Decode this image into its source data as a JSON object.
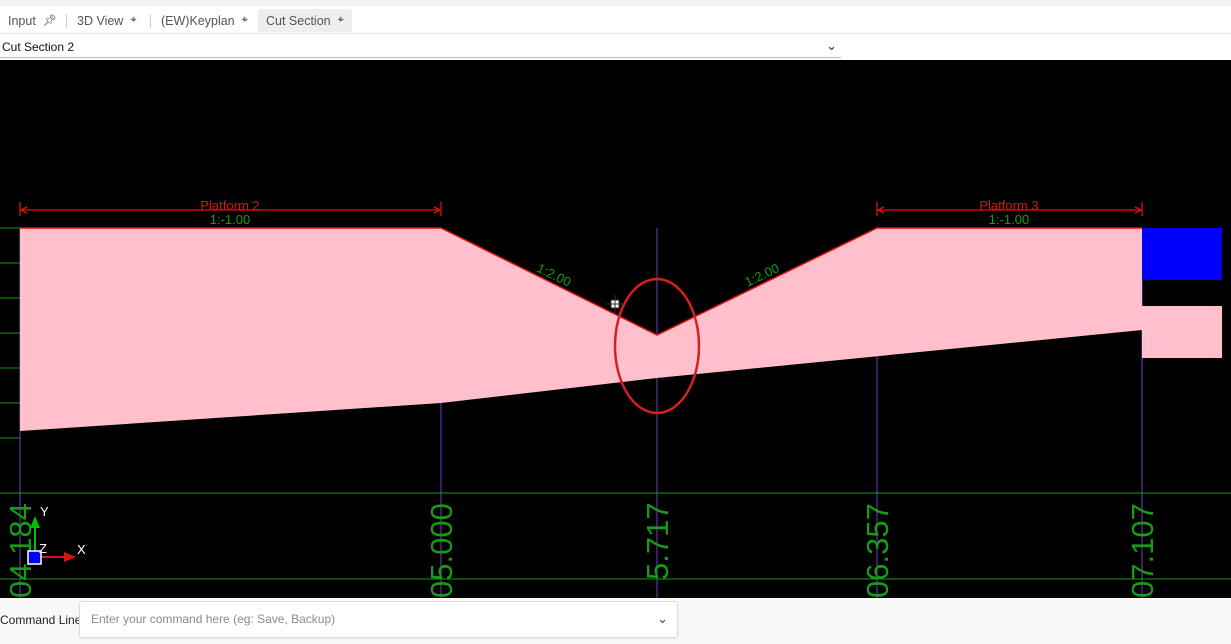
{
  "tabs": [
    {
      "label": "Input",
      "pinned": true
    },
    {
      "label": "3D View",
      "pinned": false
    },
    {
      "label": "(EW)Keyplan",
      "pinned": false
    },
    {
      "label": "Cut Section",
      "pinned": false,
      "active": true
    }
  ],
  "view_selector": {
    "value": "Cut Section 2"
  },
  "drawing": {
    "platforms": [
      {
        "name": "Platform 2",
        "slope": "1:-1.00"
      },
      {
        "name": "Platform 3",
        "slope": "1:-1.00"
      }
    ],
    "side_slopes": [
      "1:2.00",
      "1:2.00"
    ],
    "chainages": [
      "04.184",
      "05.000",
      "5.717",
      "06.357",
      "07.107"
    ],
    "axis_labels": {
      "x": "X",
      "y": "Y",
      "z": "Z"
    },
    "colors": {
      "fill": "#ffc0cb",
      "edge": "#e01010",
      "grid": "#00ff00",
      "gridline": "#7040c0",
      "text_green": "#169c16",
      "block": "#0000ff",
      "highlight": "#d81f1f"
    }
  },
  "command_line": {
    "label": "Command Line:",
    "placeholder": "Enter your command here (eg: Save, Backup)"
  }
}
